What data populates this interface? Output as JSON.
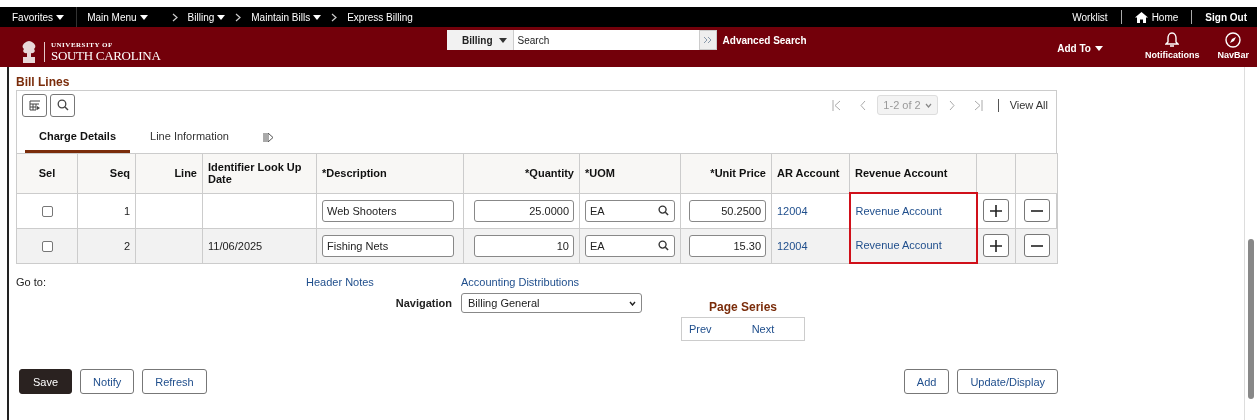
{
  "top_nav": {
    "favorites": "Favorites",
    "main_menu": "Main Menu",
    "breadcrumbs": [
      {
        "label": "Billing",
        "dropdown": true
      },
      {
        "label": "Maintain Bills",
        "dropdown": true
      },
      {
        "label": "Express Billing",
        "dropdown": false
      }
    ],
    "worklist": "Worklist",
    "home": "Home",
    "sign_out": "Sign Out"
  },
  "header": {
    "logo_small": "UNIVERSITY OF",
    "logo_large": "SOUTH CAROLINA",
    "search_scope": "Billing",
    "search_placeholder": "Search",
    "advanced_search": "Advanced Search",
    "add_to": "Add To",
    "notifications": "Notifications",
    "navbar": "NavBar"
  },
  "section_title": "Bill Lines",
  "pager": {
    "range": "1-2 of 2",
    "view_all": "View All"
  },
  "tabs": [
    {
      "label": "Charge Details",
      "selected": true
    },
    {
      "label": "Line Information",
      "selected": false
    }
  ],
  "table": {
    "revenue_column_highlighted": true,
    "columns": [
      "Sel",
      "Seq",
      "Line",
      "Identifier Look Up Date",
      "*Description",
      "*Quantity",
      "*UOM",
      "*Unit Price",
      "AR Account",
      "Revenue Account"
    ],
    "rows": [
      {
        "checked": false,
        "seq": "1",
        "description": "Web Shooters",
        "quantity": "25.0000",
        "uom": "EA",
        "unit_price": "50.2500",
        "ar_account": "12004",
        "revenue_account": "Revenue Account"
      },
      {
        "checked": false,
        "seq": "2",
        "date": "11/06/2025",
        "description": "Fishing Nets",
        "quantity": "10",
        "uom": "EA",
        "unit_price": "15.30",
        "ar_account": "12004",
        "revenue_account": "Revenue Account"
      }
    ]
  },
  "goto": {
    "label": "Go to:",
    "links": [
      "Header Notes",
      "Accounting Distributions"
    ]
  },
  "navigation": {
    "label": "Navigation",
    "value": "Billing General"
  },
  "page_series": {
    "title": "Page Series",
    "links": [
      "Prev",
      "Next"
    ]
  },
  "left_buttons": [
    {
      "label": "Save",
      "kind": "primary"
    },
    {
      "label": "Notify",
      "kind": "secondary"
    },
    {
      "label": "Refresh",
      "kind": "secondary"
    }
  ],
  "right_buttons": [
    "Add",
    "Update/Display"
  ]
}
